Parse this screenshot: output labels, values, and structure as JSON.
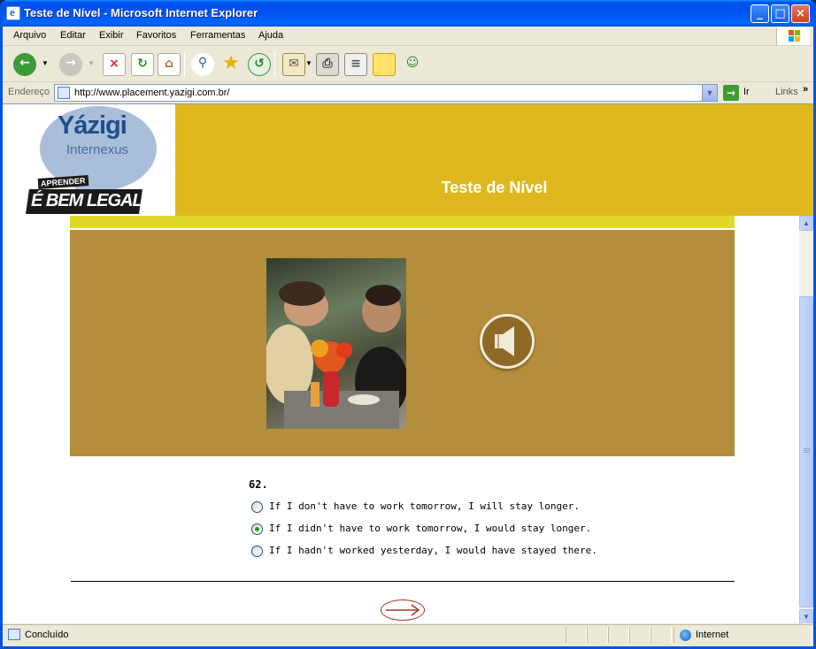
{
  "window": {
    "title": "Teste de Nível - Microsoft Internet Explorer"
  },
  "menu": [
    "Arquivo",
    "Editar",
    "Exibir",
    "Favoritos",
    "Ferramentas",
    "Ajuda"
  ],
  "address": {
    "label": "Endereço",
    "url": "http://www.placement.yazigi.com.br/",
    "go_label": "Ir",
    "links_label": "Links",
    "more": "»"
  },
  "banner": {
    "brand": "Yázigi",
    "brand_sub": "Internexus",
    "slogan_small": "APRENDER",
    "slogan_big": "É BEM LEGAL",
    "title": "Teste de Nível"
  },
  "question": {
    "number": "62.",
    "options": [
      {
        "text": "If I don't have to work tomorrow, I will stay longer.",
        "checked": false
      },
      {
        "text": "If I didn't have to work tomorrow, I would stay longer.",
        "checked": true
      },
      {
        "text": "If I hadn't worked yesterday, I would have stayed there.",
        "checked": false
      }
    ]
  },
  "status": {
    "text": "Concluído",
    "zone": "Internet"
  },
  "colors": {
    "gold": "#dfb81e",
    "panel": "#b58e3b",
    "strip": "#dfd92c",
    "title_blue": "#0053ee"
  }
}
